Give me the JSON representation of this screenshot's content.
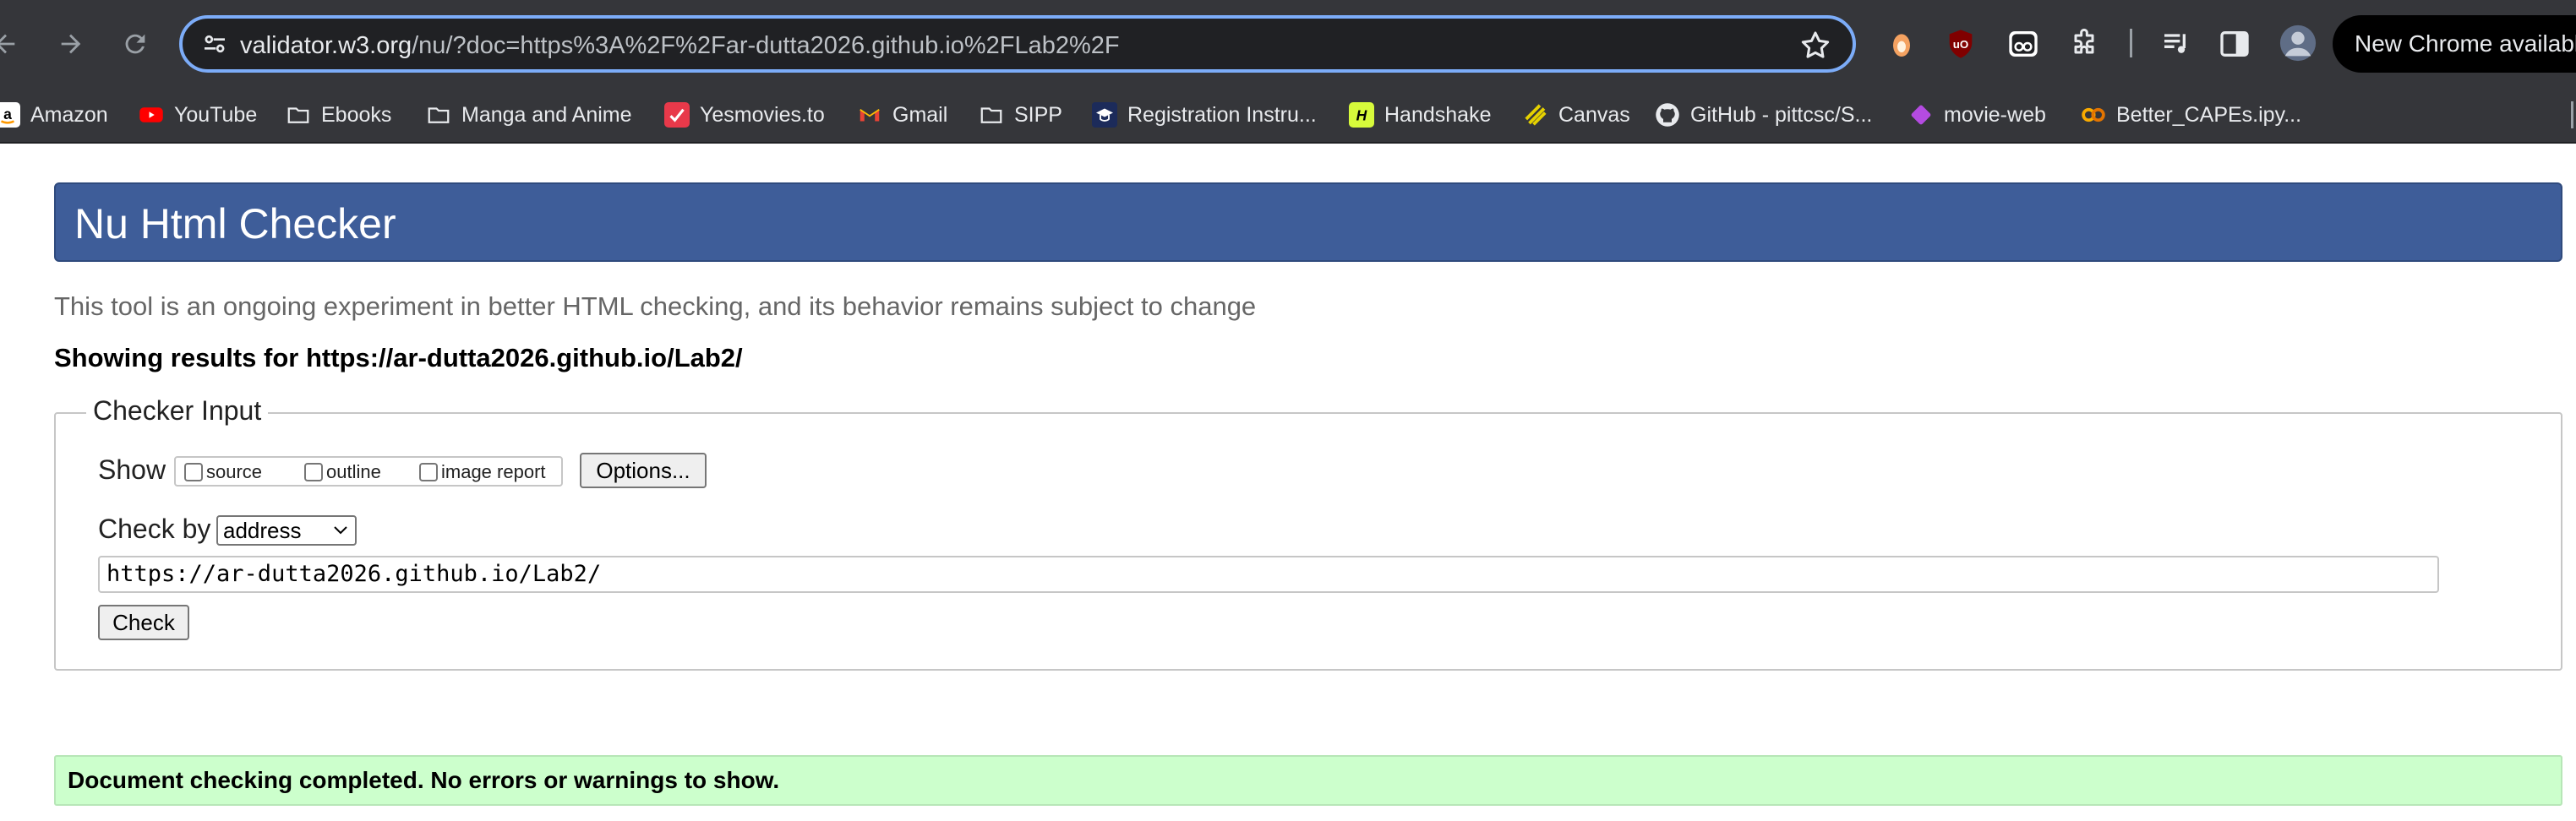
{
  "browser": {
    "url_host": "validator.w3.org",
    "url_rest": "/nu/?doc=https%3A%2F%2Far-dutta2026.github.io%2FLab2%2F",
    "update_label": "New Chrome available",
    "extension_icons": [
      "sprite-icon",
      "ublock-icon",
      "eyes-icon",
      "puzzle-extensions-icon",
      "media-queue-icon",
      "side-panel-icon",
      "profile-avatar-icon"
    ]
  },
  "bookmarks": [
    {
      "label": "Amazon",
      "icon": "amazon-icon",
      "color": "#ff9900"
    },
    {
      "label": "YouTube",
      "icon": "youtube-icon",
      "color": "#ff0000"
    },
    {
      "label": "Ebooks",
      "icon": "folder-icon"
    },
    {
      "label": "Manga and Anime",
      "icon": "folder-icon"
    },
    {
      "label": "Yesmovies.to",
      "icon": "yesmovies-icon",
      "color": "#e8394a"
    },
    {
      "label": "Gmail",
      "icon": "gmail-icon"
    },
    {
      "label": "SIPP",
      "icon": "folder-icon"
    },
    {
      "label": "Registration Instru...",
      "icon": "registration-icon"
    },
    {
      "label": "Handshake",
      "icon": "handshake-icon",
      "color": "#d7fa3b"
    },
    {
      "label": "Canvas",
      "icon": "canvas-icon",
      "color": "#e5d100"
    },
    {
      "label": "GitHub - pittcsc/S...",
      "icon": "github-icon"
    },
    {
      "label": "movie-web",
      "icon": "movie-web-icon",
      "color": "#b44be1"
    },
    {
      "label": "Better_CAPEs.ipy...",
      "icon": "colab-icon",
      "color": "#f9ab00"
    }
  ],
  "page": {
    "title": "Nu Html Checker",
    "intro": "This tool is an ongoing experiment in better HTML checking, and its behavior remains subject to change",
    "results_heading": "Showing results for https://ar-dutta2026.github.io/Lab2/",
    "checker_legend": "Checker Input",
    "show_label": "Show",
    "show_options": [
      "source",
      "outline",
      "image report"
    ],
    "options_button": "Options...",
    "check_by_label": "Check by",
    "check_by_value": "address",
    "address_value": "https://ar-dutta2026.github.io/Lab2/",
    "check_button": "Check",
    "success_message": "Document checking completed. No errors or warnings to show.",
    "colors": {
      "title_bar": "#3e5d99",
      "success_bg": "#ccffcc",
      "omnibox_focus": "#7cacf8"
    }
  }
}
